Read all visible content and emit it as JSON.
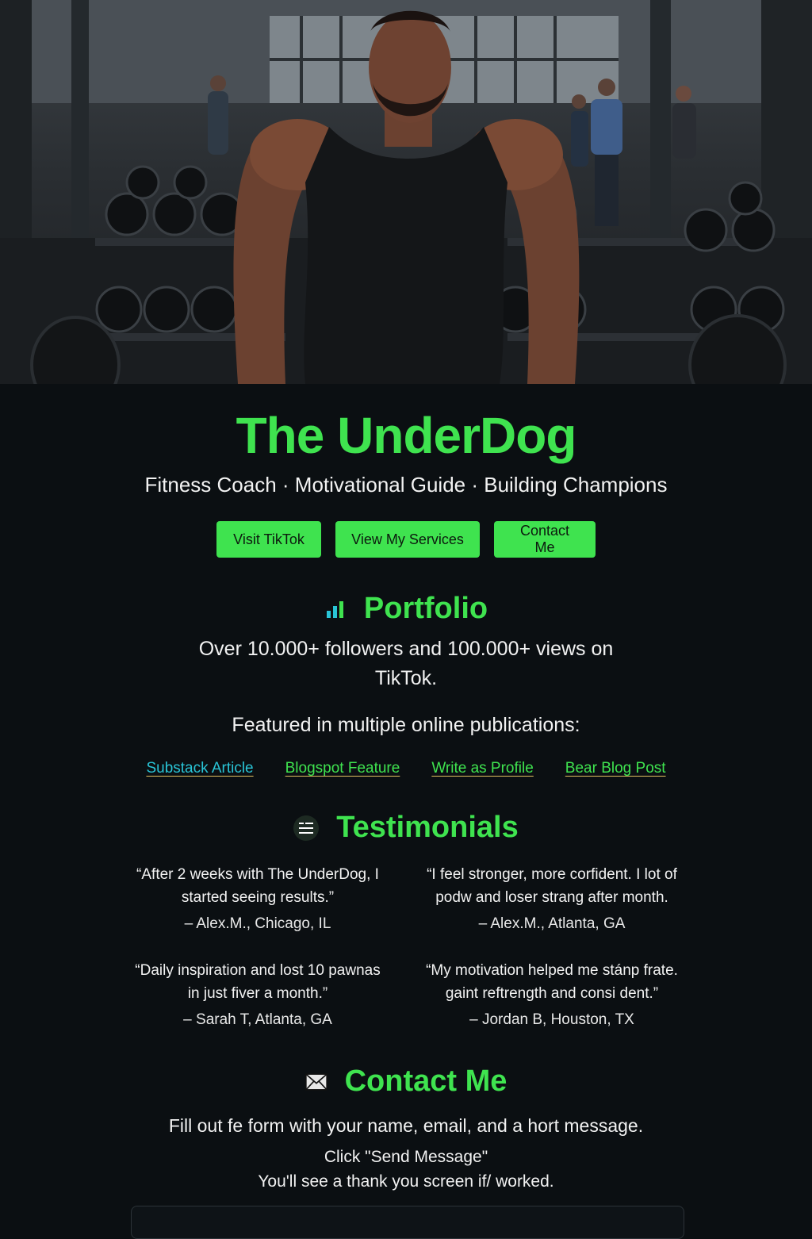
{
  "hero": {
    "image_alt": "Fitness coach in a gym"
  },
  "brand": {
    "title": "The UnderDog",
    "tagline": "Fitness Coach · Motivational Guide · Building Champions"
  },
  "actions": [
    {
      "label": "Visit TikTok"
    },
    {
      "label": "View My Services"
    },
    {
      "label": "Contact Me"
    }
  ],
  "portfolio": {
    "heading": "Portfolio",
    "icon": "bar-chart-icon",
    "stats_line1": "Over 10.000+ followers and 100.000+ views on",
    "stats_line2": "TikTok.",
    "featured_text": "Featured in multiple online publications:",
    "links": [
      {
        "label": "Substack Article",
        "color": "#29c4d6"
      },
      {
        "label": "Blogspot Feature",
        "color": "#3fe34f"
      },
      {
        "label": "Write as Profile",
        "color": "#3fe34f"
      },
      {
        "label": "Bear Blog Post",
        "color": "#3fe34f"
      }
    ]
  },
  "testimonials": {
    "heading": "Testimonials",
    "icon": "list-icon",
    "items": [
      {
        "quote_line1": "“After 2 weeks with The UnderDog, I",
        "quote_line2": "started seeing results.”",
        "author": "– Alex.M., Chicago, IL"
      },
      {
        "quote_line1": "“I feel stronger, more corfident. I  lot of",
        "quote_line2": "podw and loser strang after month.",
        "author": "– Alex.M., Atlanta, GA"
      },
      {
        "quote_line1": "“Daily inspiration and lost 10 pawnas",
        "quote_line2": "in just fiver a month.”",
        "author": "– Sarah T, Atlanta, GA"
      },
      {
        "quote_line1": "“My motivation helped me stánp frate.",
        "quote_line2": "gaint reftrength and consi dent.”",
        "author": "– Jordan B, Houston, TX"
      }
    ]
  },
  "contact": {
    "heading": "Contact Me",
    "icon": "envelope-icon",
    "line1": "Fill out fe  form with your name, email, and a hort message.",
    "line2": "Click \"Send Message\"",
    "line3": "You'll see a thank you screen if/ worked."
  },
  "colors": {
    "accent": "#3fe34f",
    "background": "#0b0f12",
    "link_alt": "#29c4d6"
  }
}
